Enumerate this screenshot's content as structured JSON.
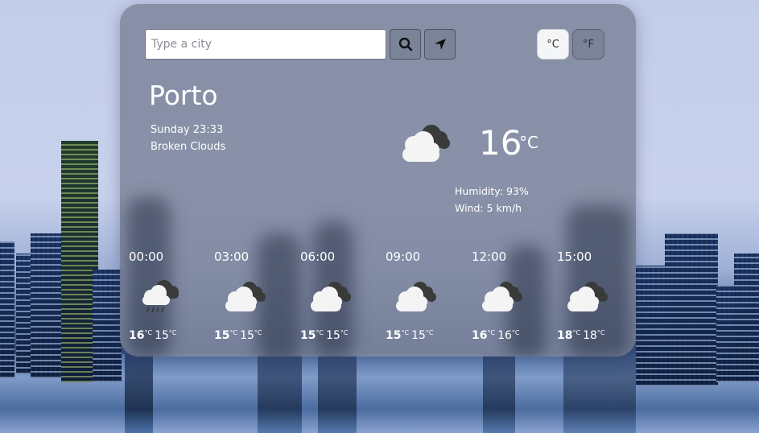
{
  "search": {
    "placeholder": "Type a city"
  },
  "units": {
    "celsius_label": "°C",
    "fahrenheit_label": "°F",
    "active": "celsius"
  },
  "current": {
    "city": "Porto",
    "datetime": "Sunday 23:33",
    "description": "Broken Clouds",
    "icon": "broken-clouds-icon",
    "temperature": "16",
    "unit": "°C",
    "humidity": "Humidity: 93%",
    "wind": "Wind: 5 km/h"
  },
  "forecast": [
    {
      "time": "00:00",
      "icon": "rain-cloud-icon",
      "max": "16",
      "min": "15",
      "unit": "°C"
    },
    {
      "time": "03:00",
      "icon": "broken-clouds-icon",
      "max": "15",
      "min": "15",
      "unit": "°C"
    },
    {
      "time": "06:00",
      "icon": "broken-clouds-icon",
      "max": "15",
      "min": "15",
      "unit": "°C"
    },
    {
      "time": "09:00",
      "icon": "broken-clouds-icon",
      "max": "15",
      "min": "15",
      "unit": "°C"
    },
    {
      "time": "12:00",
      "icon": "broken-clouds-icon",
      "max": "16",
      "min": "16",
      "unit": "°C"
    },
    {
      "time": "15:00",
      "icon": "broken-clouds-icon",
      "max": "18",
      "min": "18",
      "unit": "°C"
    }
  ],
  "colors": {
    "card": "#80889e",
    "text": "#ffffff",
    "button": "#7b8398"
  }
}
